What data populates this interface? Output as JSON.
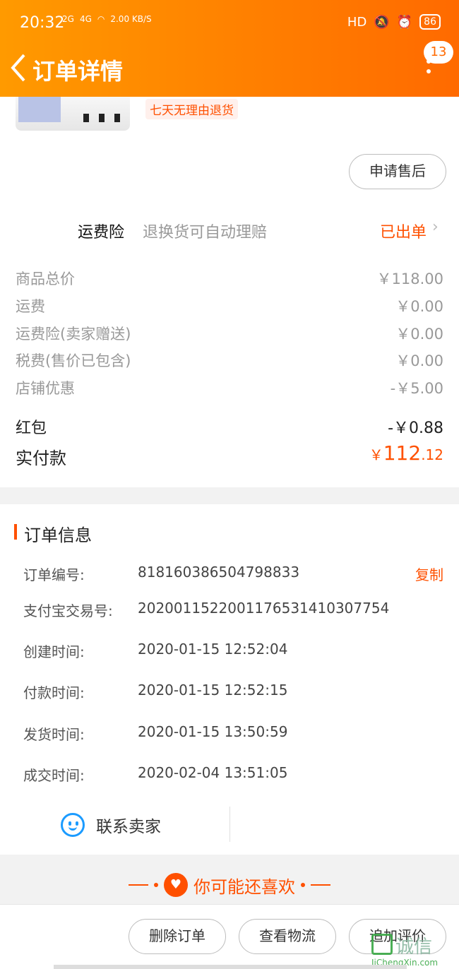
{
  "status_bar": {
    "time": "20:32",
    "net1": "2G",
    "net2": "4G",
    "speed": "2.00 KB/S",
    "hd": "HD",
    "battery": "86"
  },
  "nav": {
    "title": "订单详情",
    "badge_count": "13"
  },
  "product": {
    "tag": "七天无理由退货",
    "after_sale_button": "申请售后"
  },
  "insurance": {
    "label": "运费险",
    "desc": "退换货可自动理赔",
    "status": "已出单"
  },
  "fees": [
    {
      "label": "商品总价",
      "value": "￥118.00"
    },
    {
      "label": "运费",
      "value": "￥0.00"
    },
    {
      "label": "运费险(卖家赠送)",
      "value": "￥0.00"
    },
    {
      "label": "税费(售价已包含)",
      "value": "￥0.00"
    },
    {
      "label": "店铺优惠",
      "value": "-￥5.00"
    }
  ],
  "red_packet": {
    "label": "红包",
    "value": "-￥0.88"
  },
  "paid": {
    "label": "实付款",
    "currency": "￥",
    "integer": "112",
    "decimal": ".12"
  },
  "order_info": {
    "title": "订单信息",
    "copy_label": "复制",
    "rows": [
      {
        "label": "订单编号:",
        "value": "818160386504798833"
      },
      {
        "label": "支付宝交易号:",
        "value": "2020011522001176531410307754"
      },
      {
        "label": "创建时间:",
        "value": "2020-01-15 12:52:04"
      },
      {
        "label": "付款时间:",
        "value": "2020-01-15 12:52:15"
      },
      {
        "label": "发货时间:",
        "value": "2020-01-15 13:50:59"
      },
      {
        "label": "成交时间:",
        "value": "2020-02-04 13:51:05"
      }
    ],
    "contact_seller": "联系卖家"
  },
  "recommend": {
    "title": "你可能还喜欢"
  },
  "footer": {
    "delete_order": "删除订单",
    "view_logistics": "查看物流",
    "add_review": "追加评价"
  },
  "watermark": {
    "text": "诚信",
    "sub": "JiChengXin.com"
  },
  "colors": {
    "accent": "#ff5000",
    "header_start": "#ff9a00",
    "header_end": "#ff6a00"
  }
}
